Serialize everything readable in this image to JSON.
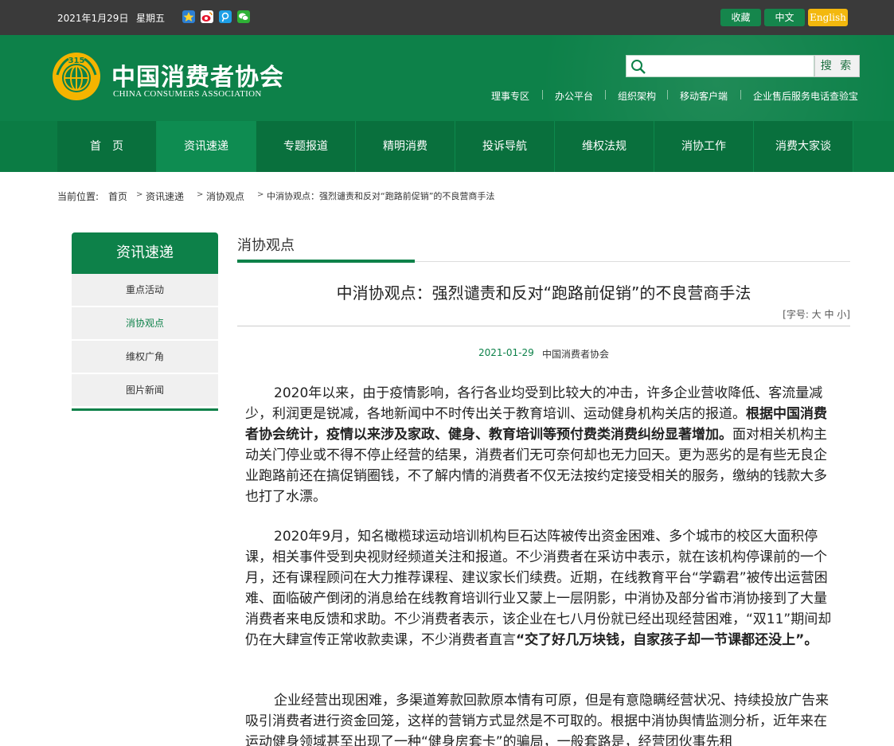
{
  "topbar": {
    "date": "2021年1月29日",
    "weekday": "星期五",
    "share_icons": [
      "qzone-icon",
      "weibo-icon",
      "tencent-weibo-icon",
      "wechat-icon"
    ],
    "favorite": "收藏",
    "chinese": "中文",
    "english": "English"
  },
  "header": {
    "logo_cn": "中国消费者协会",
    "logo_en": "CHINA CONSUMERS ASSOCIATION",
    "search_placeholder": "",
    "search_button": "搜 索",
    "quick_links": [
      "理事专区",
      "办公平台",
      "组织架构",
      "移动客户端",
      "企业售后服务电话查验宝"
    ]
  },
  "nav": {
    "items": [
      "首　页",
      "资讯速递",
      "专题报道",
      "精明消费",
      "投诉导航",
      "维权法规",
      "消协工作",
      "消费大家谈"
    ],
    "active": "资讯速递"
  },
  "breadcrumb": {
    "prefix": "当前位置:",
    "items": [
      "首页",
      "资讯速递",
      "消协观点",
      "中消协观点：强烈谴责和反对“跑路前促销”的不良营商手法"
    ]
  },
  "sidebar": {
    "title": "资讯速递",
    "items": [
      "重点活动",
      "消协观点",
      "维权广角",
      "图片新闻"
    ],
    "active": "消协观点"
  },
  "article": {
    "section": "消协观点",
    "title": "中消协观点：强烈谴责和反对“跑路前促销”的不良营商手法",
    "font_size_label": "[字号: 大 中 小]",
    "date": "2021-01-29",
    "source": "中国消费者协会",
    "p1_a": "2020年以来，由于疫情影响，各行各业均受到比较大的冲击，许多企业营收降低、客流量减少，利润更是锐减，各地新闻中不时传出关于教育培训、运动健身机构关店的报道。",
    "p1_b": "根据中国消费者协会统计，疫情以来涉及家政、健身、教育培训等预付费类消费纠纷显著增加。",
    "p1_c": "面对相关机构主动关门停业或不得不停止经营的结果，消费者们无可奈何却也无力回天。更为恶劣的是有些无良企业跑路前还在搞促销圈钱，不了解内情的消费者不仅无法按约定接受相关的服务，缴纳的钱款大多也打了水漂。",
    "p2_a": "2020年9月，知名橄榄球运动培训机构巨石达阵被传出资金困难、多个城市的校区大面积停课，相关事件受到央视财经频道关注和报道。不少消费者在采访中表示，就在该机构停课前的一个月，还有课程顾问在大力推荐课程、建议家长们续费。近期，在线教育平台“学霸君”被传出运营困难、面临破产倒闭的消息给在线教育培训行业又蒙上一层阴影，中消协及部分省市消协接到了大量消费者来电反馈和求助。不少消费者表示，该企业在七八月份就已经出现经营困难，“双11”期间却仍在大肆宣传正常收款卖课，不少消费者直言",
    "p2_b": "“交了好几万块钱，自家孩子却一节课都还没上”。",
    "p3": "企业经营出现困难，多渠道筹款回款原本情有可原，但是有意隐瞒经营状况、持续投放广告来吸引消费者进行资金回笼，这样的营销方式显然是不可取的。根据中消协舆情监测分析，近年来在运动健身领域甚至出现了一种“健身房套卡”的骗局，一般套路是，经营团伙事先租"
  },
  "colors": {
    "brand_green": "#0d8149",
    "topbar": "#3a3a3a",
    "english_button": "#f3b80e"
  }
}
